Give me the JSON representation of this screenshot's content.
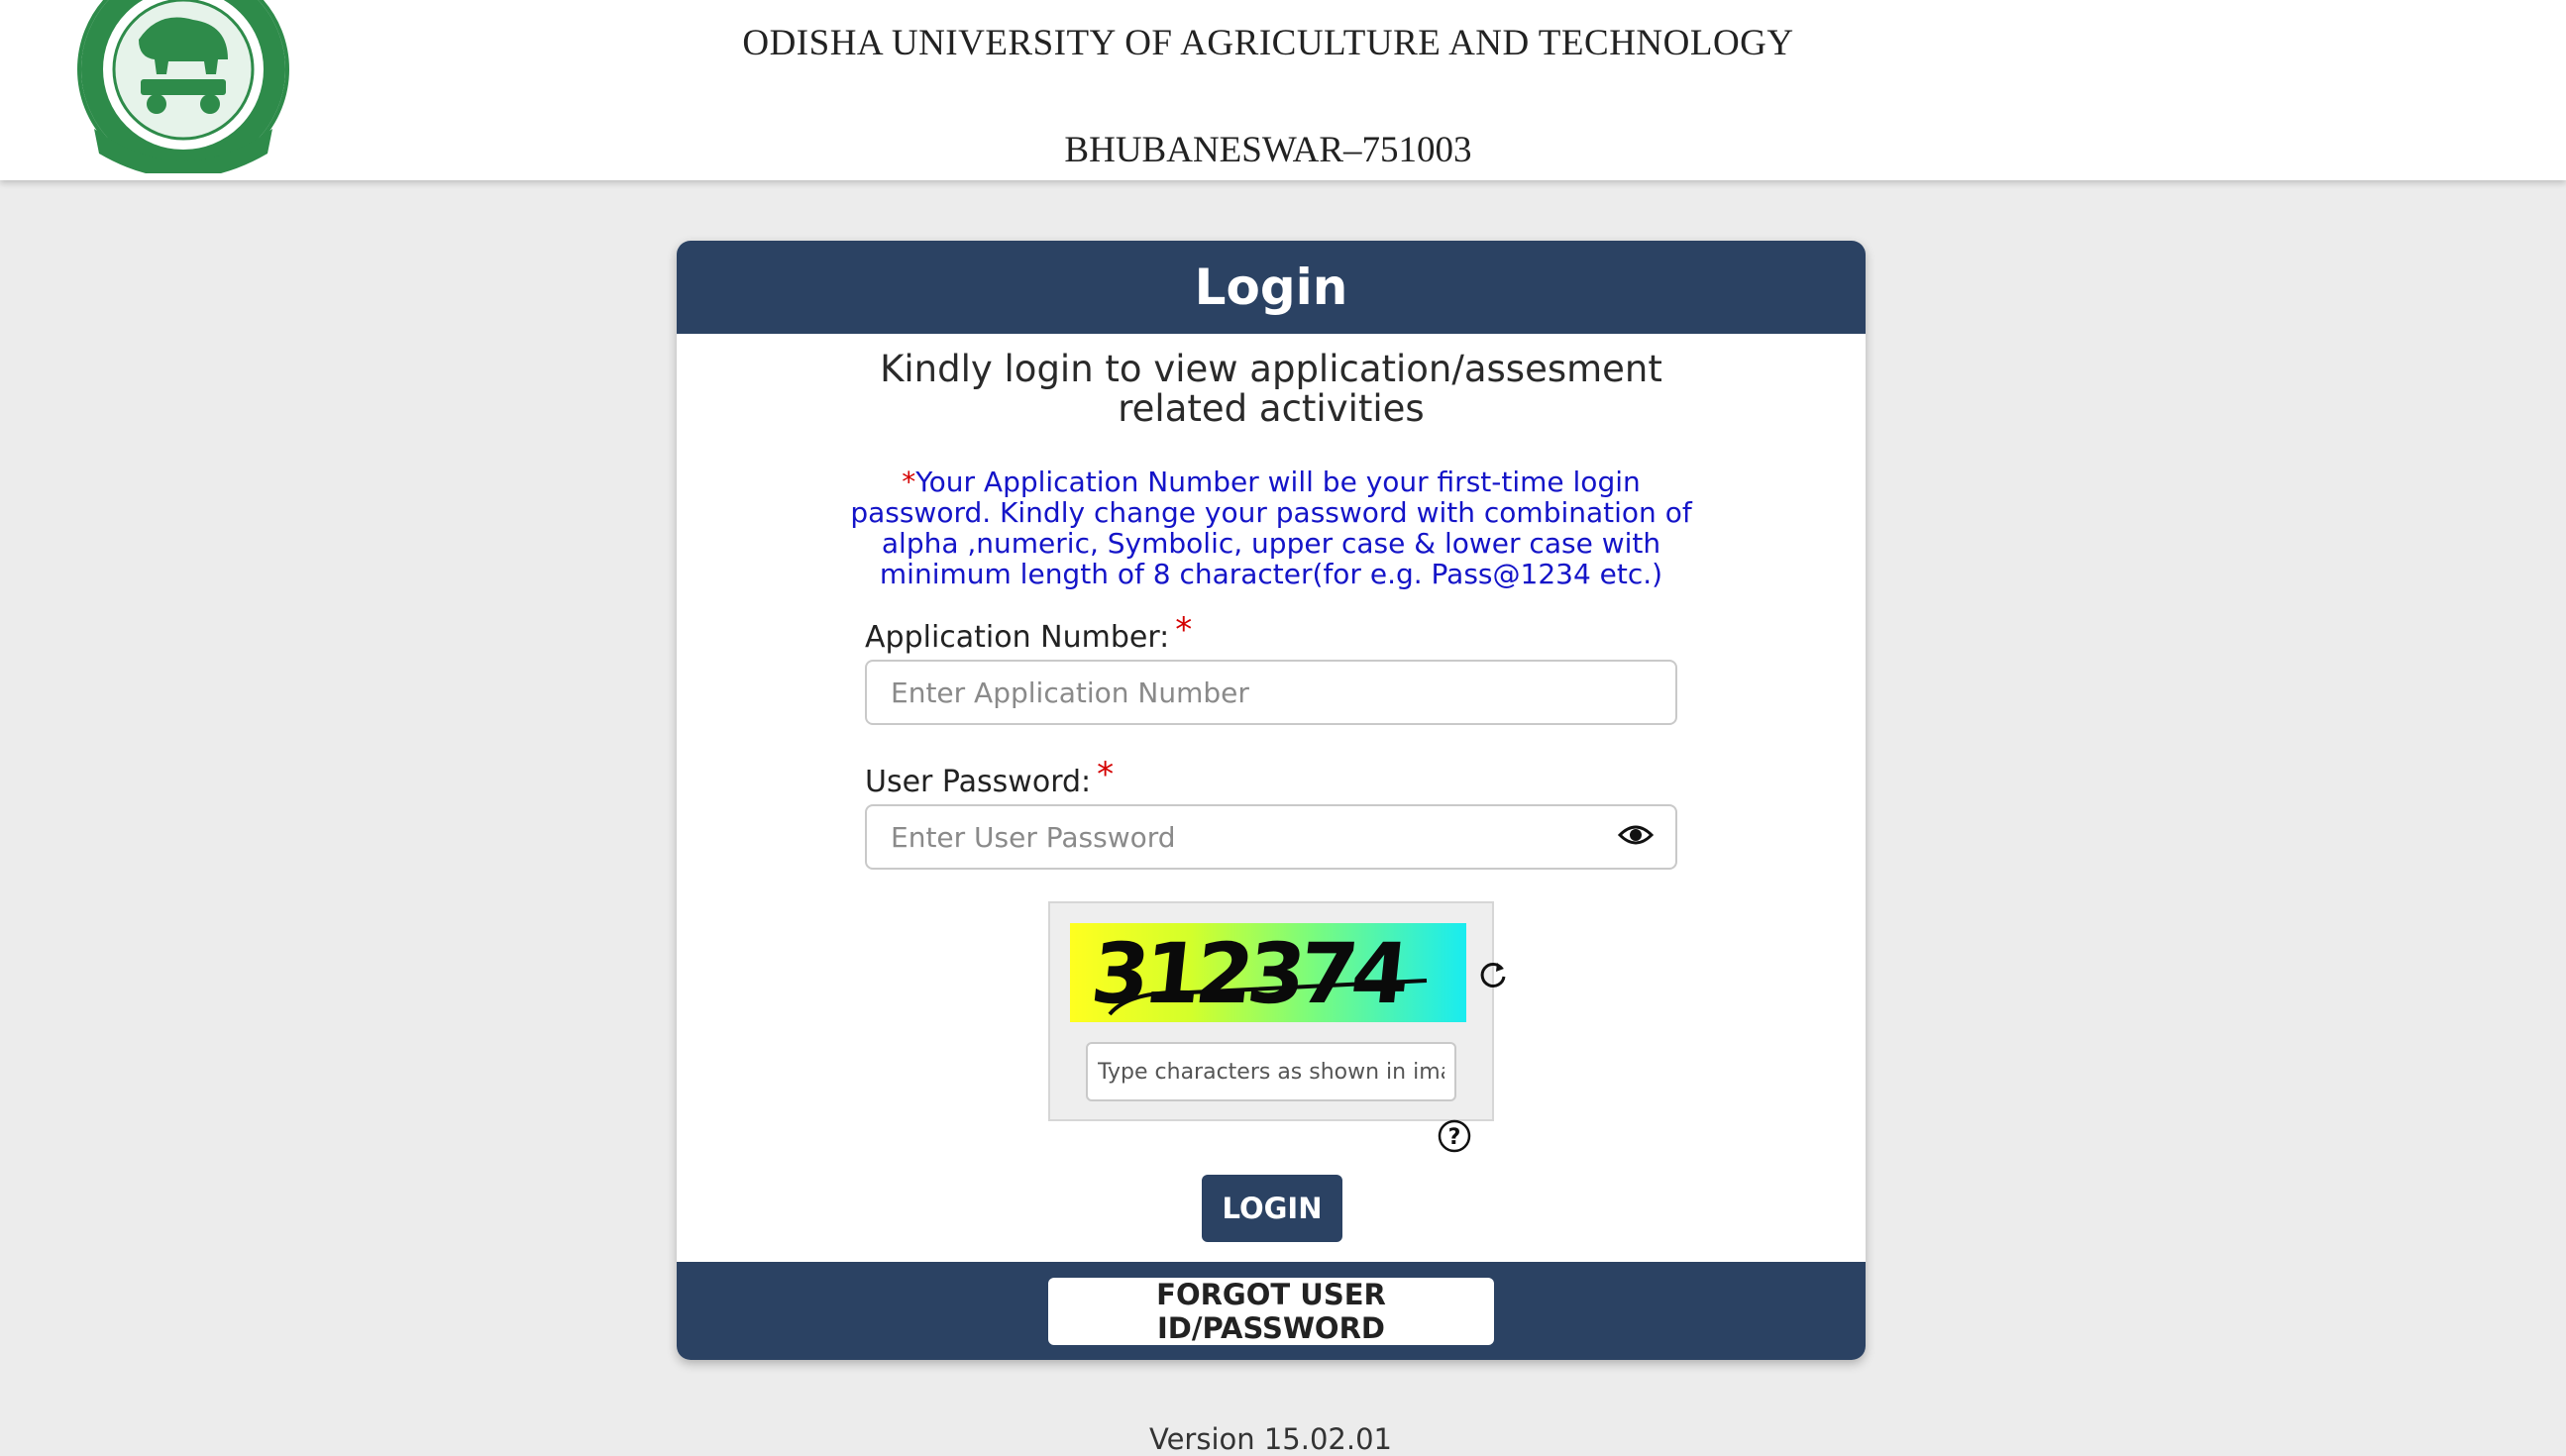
{
  "header": {
    "university_name": "ODISHA UNIVERSITY OF AGRICULTURE AND TECHNOLOGY",
    "city": "BHUBANESWAR–751003",
    "logo_icon": "university-seal-icon"
  },
  "login_card": {
    "title": "Login",
    "intro": "Kindly login to view application/assesment related activities",
    "note_star": "*",
    "note": "Your Application Number will be your first-time login password. Kindly change your password with combination of alpha ,numeric, Symbolic, upper case & lower case with minimum length of 8 character(for e.g. Pass@1234 etc.)",
    "application_number": {
      "label": "Application Number:",
      "required_mark": "*",
      "placeholder": "Enter Application Number",
      "value": ""
    },
    "password": {
      "label": "User Password:",
      "required_mark": "*",
      "placeholder": "Enter User Password",
      "value": "",
      "toggle_icon": "eye-icon"
    },
    "captcha": {
      "image_text": "312374",
      "refresh_icon": "refresh-icon",
      "placeholder": "Type characters as shown in image",
      "value": "",
      "help_icon": "help-icon"
    },
    "login_button": "LOGIN",
    "forgot_button": "FORGOT USER ID/PASSWORD"
  },
  "footer": {
    "version": "Version 15.02.01"
  },
  "colors": {
    "primary": "#2b4263",
    "background": "#ececec",
    "note_text": "#1414c8",
    "required": "#d40000",
    "logo_green": "#2e8b4a"
  }
}
